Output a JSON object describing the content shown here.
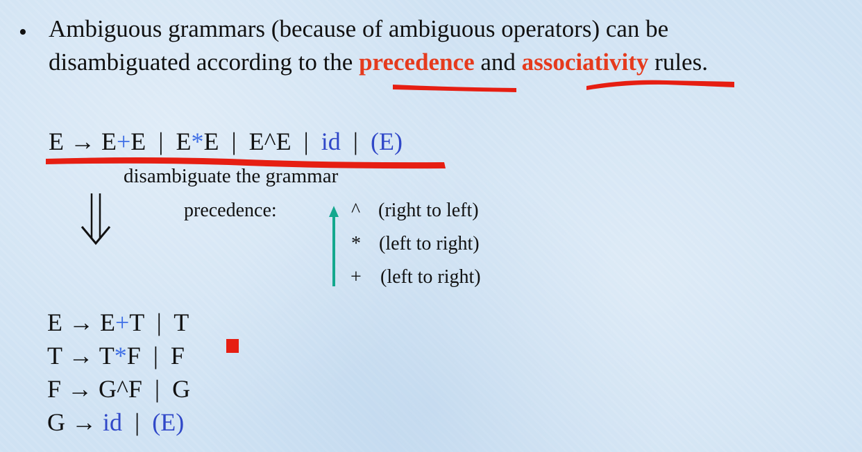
{
  "bullet": {
    "dot": "•",
    "line1": "Ambiguous grammars (because of ambiguous operators) can be",
    "line2_pre": "disambiguated according to the ",
    "line2_em1": "precedence",
    "line2_mid": " and ",
    "line2_em2": "associativity",
    "line2_post": " rules."
  },
  "ambiguous_grammar": {
    "head": "E → E",
    "plus": "+",
    "p1": "E  |  E",
    "star": "*",
    "p2": "E  |  E^E  |  ",
    "id": "id",
    "sep": "  |  ",
    "paren": "(E)"
  },
  "disambiguate_label": "disambiguate the grammar",
  "precedence": {
    "label": "precedence:",
    "rows": [
      {
        "op": "^",
        "assoc": "(right to left)"
      },
      {
        "op": "*",
        "assoc": "(left to right)"
      },
      {
        "op": "+",
        "assoc": "(left to right)"
      }
    ]
  },
  "rules": {
    "r1": {
      "a": "E → E",
      "op": "+",
      "b": "T  |  T"
    },
    "r2": {
      "a": "T → T",
      "op": "*",
      "b": "F  |  F"
    },
    "r3": {
      "a": "F → G^F  |  G"
    },
    "r4": {
      "a": "G → ",
      "id": "id",
      "sep": "  |  ",
      "paren": "(E)"
    }
  },
  "colors": {
    "highlight_red": "#e53a1d",
    "operator_blue": "#3f6fe6",
    "terminal_blue": "#3048c8",
    "arrow_teal": "#14a88e",
    "background": "#cfe2f3"
  },
  "icons": [
    "double-down-arrow-icon",
    "teal-up-arrow-icon",
    "red-square-marker"
  ]
}
